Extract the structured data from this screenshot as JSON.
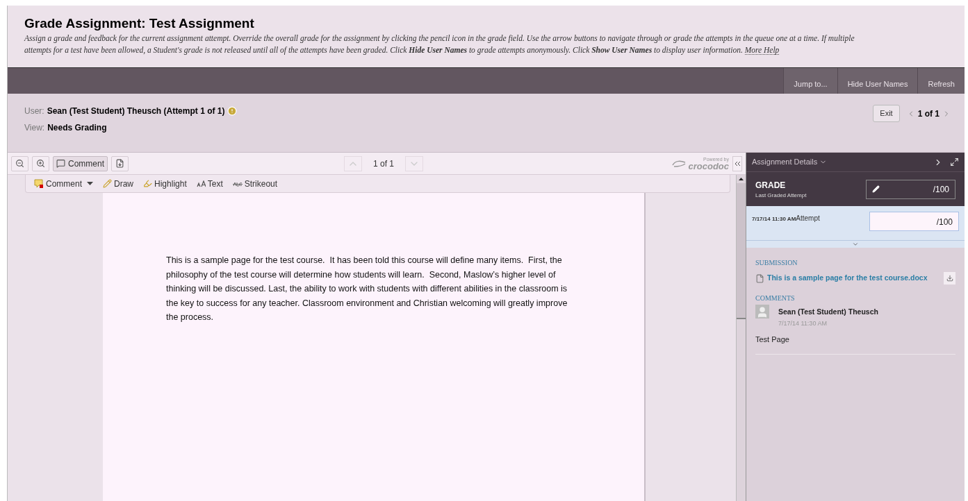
{
  "header": {
    "title": "Grade Assignment: Test Assignment",
    "instructions": "Assign a grade and feedback for the current assignment attempt. Override the overall grade for the assignment by clicking the pencil icon in the grade field. Use the arrow buttons to navigate through or grade the attempts in the queue one at a time. If multiple attempts for a test have been allowed, a Student's grade is not released until all of the attempts have been graded. Click **Hide User Names** to grade attempts anonymously. Click **Show User Names** to display user information.",
    "help_link": "More Help"
  },
  "action_bar": [
    "Jump to...",
    "Hide User Names",
    "Refresh"
  ],
  "attempt_info": {
    "user_label": "User:",
    "user": "Sean (Test Student) Theusch (Attempt 1 of 1)",
    "view_label": "View:",
    "view": "Needs Grading",
    "exit": "Exit",
    "position": "1 of 1"
  },
  "viewer": {
    "comment_button": "Comment",
    "page": "1 of 1",
    "powered_by": "Powered by",
    "brand": "crocodoc",
    "tools": [
      {
        "kind": "comment",
        "label": "Comment"
      },
      {
        "kind": "draw",
        "label": "Draw"
      },
      {
        "kind": "highlight",
        "label": "Highlight"
      },
      {
        "kind": "text",
        "label": "Text"
      },
      {
        "kind": "strikeout",
        "label": "Strikeout"
      }
    ],
    "document_text": "This is a sample page for the test course.  It has been told this course will define many items.  First, the philosophy of the test course will determine how students will learn.  Second, Maslow’s higher level of thinking will be discussed. Last, the ability to work with students with different abilities in the classroom is the key to success for any teacher. Classroom environment and Christian welcoming will greatly improve the process."
  },
  "panel": {
    "title": "Assignment Details",
    "grade_label": "GRADE",
    "grade_sub": "Last Graded Attempt",
    "grade_value": "/100",
    "attempt_date": "7/17/14 11:30 AM",
    "attempt_label": "Attempt",
    "attempt_value": "/100",
    "submission_heading": "SUBMISSION",
    "file": "This is a sample page for the test course.docx",
    "comments_heading": "COMMENTS",
    "comment": {
      "author": "Sean (Test Student) Theusch",
      "date": "7/17/14 11:30 AM",
      "text": "Test Page"
    }
  }
}
